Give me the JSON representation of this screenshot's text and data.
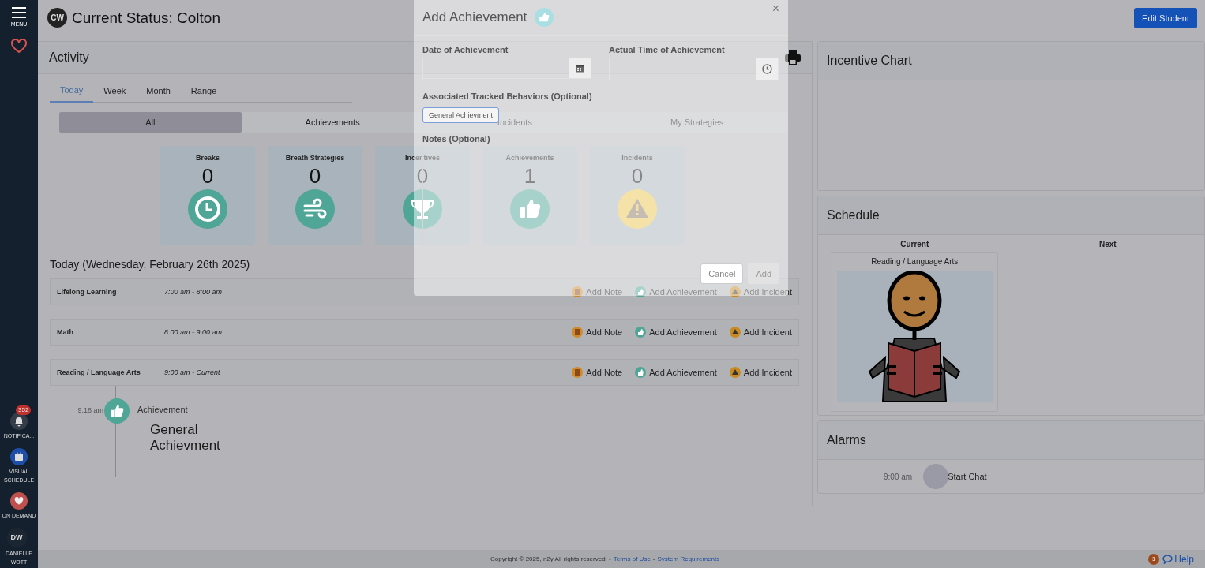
{
  "sidebar": {
    "menu_label": "MENU",
    "items": [
      {
        "kind": "bell",
        "label": "NOTIFICA...",
        "badge": "352"
      },
      {
        "kind": "calendar",
        "label": "VISUAL SCHEDULE"
      },
      {
        "kind": "heart",
        "label": "ON DEMAND"
      },
      {
        "kind": "avatar",
        "initials": "DW",
        "label": "DANIELLE WOTT"
      }
    ]
  },
  "header": {
    "initials": "CW",
    "title": "Current Status: Colton",
    "edit_button": "Edit Student"
  },
  "activity": {
    "title": "Activity",
    "periods": [
      {
        "label": "Today",
        "selected": true
      },
      {
        "label": "Week",
        "selected": false
      },
      {
        "label": "Month",
        "selected": false
      },
      {
        "label": "Range",
        "selected": false
      }
    ],
    "filters": [
      {
        "label": "All",
        "selected": true
      },
      {
        "label": "Achievements",
        "selected": false
      },
      {
        "label": "Incidents",
        "selected": false
      },
      {
        "label": "My Strategies",
        "selected": false
      }
    ],
    "stats": [
      {
        "kind": "clock",
        "label": "Breaks",
        "count": "0"
      },
      {
        "kind": "wind",
        "label": "Breath Strategies",
        "count": "0"
      },
      {
        "kind": "trophy",
        "label": "Incentives",
        "count": "0"
      },
      {
        "kind": "thumb",
        "label": "Achievements",
        "count": "1"
      },
      {
        "kind": "warning",
        "label": "Incidents",
        "count": "0"
      }
    ],
    "date_heading": "Today (Wednesday, February 26th 2025)",
    "schedule_rows": [
      {
        "name": "Lifelong Learning",
        "time": "7:00 am - 8:00 am",
        "actions": [
          {
            "kind": "note",
            "label": "Add Note"
          },
          {
            "kind": "achievement",
            "label": "Add Achievement"
          },
          {
            "kind": "incident",
            "label": "Add Incident"
          }
        ]
      },
      {
        "name": "Math",
        "time": "8:00 am - 9:00 am",
        "actions": [
          {
            "kind": "note",
            "label": "Add Note"
          },
          {
            "kind": "achievement",
            "label": "Add Achievement"
          },
          {
            "kind": "incident",
            "label": "Add Incident"
          }
        ]
      },
      {
        "name": "Reading / Language Arts",
        "time": "9:00 am - Current",
        "actions": [
          {
            "kind": "note",
            "label": "Add Note"
          },
          {
            "kind": "achievement",
            "label": "Add Achievement"
          },
          {
            "kind": "incident",
            "label": "Add Incident"
          }
        ]
      }
    ],
    "timeline": [
      {
        "time": "9:18 am",
        "type": "Achievement",
        "text": "General Achievment"
      }
    ]
  },
  "incentive_chart": {
    "title": "Incentive Chart"
  },
  "schedule": {
    "title": "Schedule",
    "current_label": "Current",
    "next_label": "Next",
    "current_item": "Reading / Language Arts"
  },
  "alarms": {
    "title": "Alarms",
    "items": [
      {
        "time": "9:00 am",
        "label": "Start Chat"
      }
    ]
  },
  "footer": {
    "parts": [
      {
        "kind": "text",
        "text": "Copyright © 2025, n2y All rights reserved. -"
      },
      {
        "kind": "link",
        "text": "Terms of Use"
      },
      {
        "kind": "text",
        "text": "-"
      },
      {
        "kind": "link",
        "text": "System Requirements"
      }
    ],
    "help_badge": "3",
    "help": "Help"
  },
  "modal": {
    "title": "Add Achievement",
    "close": "×",
    "date_label": "Date of Achievement",
    "time_label": "Actual Time of Achievement",
    "behaviors_label": "Associated Tracked Behaviors (Optional)",
    "behaviors": [
      "General Achievment"
    ],
    "notes_label": "Notes (Optional)",
    "buttons": [
      {
        "label": "Cancel",
        "disabled": false
      },
      {
        "label": "Add",
        "disabled": true
      }
    ]
  }
}
